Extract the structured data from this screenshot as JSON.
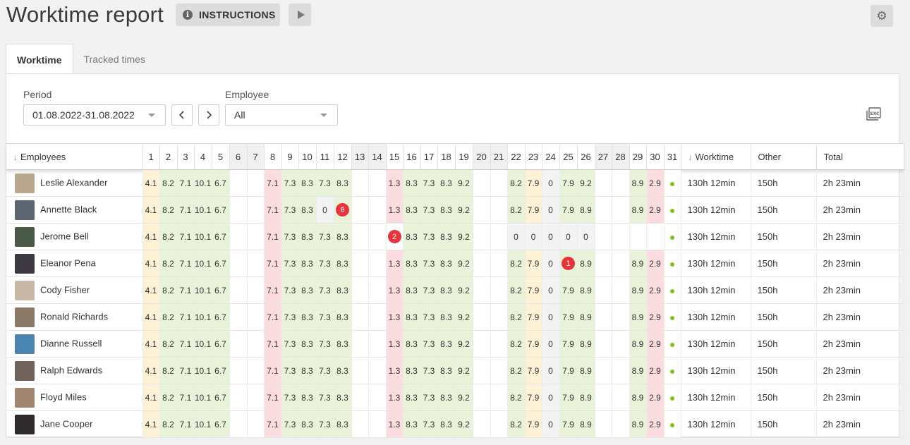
{
  "header": {
    "title": "Worktime report",
    "instructions_label": "INSTRUCTIONS",
    "info_icon": "info-icon",
    "play_icon": "play-icon",
    "settings_icon": "gear-icon"
  },
  "tabs": [
    {
      "label": "Worktime",
      "active": true
    },
    {
      "label": "Tracked times",
      "active": false
    }
  ],
  "filters": {
    "period_label": "Period",
    "period_value": "01.08.2022-31.08.2022",
    "employee_label": "Employee",
    "employee_value": "All",
    "export_icon": "excel-export-icon"
  },
  "colors": {
    "yellow_cell": "#fdf1d6",
    "green_cell": "#e8f3d9",
    "red_cell": "#fbdde0",
    "gray_cell": "#f3f3f3",
    "badge": "#e8323c",
    "status_dot": "#7dc31f"
  },
  "table": {
    "employees_header": "Employees",
    "worktime_header": "Worktime",
    "other_header": "Other",
    "total_header": "Total",
    "days": [
      "1",
      "2",
      "3",
      "4",
      "5",
      "6",
      "7",
      "8",
      "9",
      "10",
      "11",
      "12",
      "13",
      "14",
      "15",
      "16",
      "17",
      "18",
      "19",
      "20",
      "21",
      "22",
      "23",
      "24",
      "25",
      "26",
      "27",
      "28",
      "29",
      "30",
      "31"
    ],
    "weekend_days": [
      6,
      7,
      13,
      14,
      20,
      21,
      27,
      28
    ],
    "rows": [
      {
        "name": "Leslie Alexander",
        "avatar_color": "#b9a78f",
        "cells": [
          "4.1",
          "8.2",
          "7.1",
          "10.1",
          "6.7",
          "",
          "",
          "7.1",
          "7.3",
          "8.3",
          "7.3",
          "8.3",
          "",
          "",
          "1.3",
          "8.3",
          "7.3",
          "8.3",
          "9.2",
          "",
          "",
          "8.2",
          "7.9",
          "0",
          "7.9",
          "9.2",
          "",
          "",
          "8.9",
          "2.9",
          "•"
        ],
        "worktime": "130h 12min",
        "other": "150h",
        "total": "2h 23min"
      },
      {
        "name": "Annette Black",
        "avatar_color": "#5d6670",
        "cells": [
          "4.1",
          "8.2",
          "7.1",
          "10.1",
          "6.7",
          "",
          "",
          "7.1",
          "7.3",
          "8.3",
          "0",
          "!8",
          "",
          "",
          "1.3",
          "8.3",
          "7.3",
          "8.3",
          "9.2",
          "",
          "",
          "8.2",
          "7.9",
          "0",
          "7.9",
          "8.9",
          "",
          "",
          "8.9",
          "2.9",
          "•"
        ],
        "worktime": "130h 12min",
        "other": "150h",
        "total": "2h 23min"
      },
      {
        "name": "Jerome Bell",
        "avatar_color": "#4a5a48",
        "cells": [
          "4.1",
          "8.2",
          "7.1",
          "10.1",
          "6.7",
          "",
          "",
          "7.1",
          "7.3",
          "8.3",
          "7.3",
          "8.3",
          "",
          "",
          "!2",
          "8.3",
          "7.3",
          "8.3",
          "9.2",
          "",
          "",
          "0",
          "0",
          "0",
          "0",
          "0",
          "",
          "",
          "",
          "",
          "•"
        ],
        "worktime": "130h 12min",
        "other": "150h",
        "total": "2h 23min"
      },
      {
        "name": "Eleanor Pena",
        "avatar_color": "#3c3a40",
        "cells": [
          "4.1",
          "8.2",
          "7.1",
          "10.1",
          "6.7",
          "",
          "",
          "7.1",
          "7.3",
          "8.3",
          "7.3",
          "8.3",
          "",
          "",
          "1.3",
          "8.3",
          "7.3",
          "8.3",
          "9.2",
          "",
          "",
          "8.2",
          "7.9",
          "0",
          "!1",
          "8.9",
          "",
          "",
          "8.9",
          "2.9",
          "•"
        ],
        "worktime": "130h 12min",
        "other": "150h",
        "total": "2h 23min"
      },
      {
        "name": "Cody Fisher",
        "avatar_color": "#c9b8a6",
        "cells": [
          "4.1",
          "8.2",
          "7.1",
          "10.1",
          "6.7",
          "",
          "",
          "7.1",
          "7.3",
          "8.3",
          "7.3",
          "8.3",
          "",
          "",
          "1.3",
          "8.3",
          "7.3",
          "8.3",
          "9.2",
          "",
          "",
          "8.2",
          "7.9",
          "0",
          "7.9",
          "8.9",
          "",
          "",
          "8.9",
          "2.9",
          "•"
        ],
        "worktime": "130h 12min",
        "other": "150h",
        "total": "2h 23min"
      },
      {
        "name": "Ronald Richards",
        "avatar_color": "#8c7a68",
        "cells": [
          "4.1",
          "8.2",
          "7.1",
          "10.1",
          "6.7",
          "",
          "",
          "7.1",
          "7.3",
          "8.3",
          "7.3",
          "8.3",
          "",
          "",
          "1.3",
          "8.3",
          "7.3",
          "8.3",
          "9.2",
          "",
          "",
          "8.2",
          "7.9",
          "0",
          "7.9",
          "8.9",
          "",
          "",
          "8.9",
          "2.9",
          "•"
        ],
        "worktime": "130h 12min",
        "other": "150h",
        "total": "2h 23min"
      },
      {
        "name": "Dianne Russell",
        "avatar_color": "#4a86b0",
        "cells": [
          "4.1",
          "8.2",
          "7.1",
          "10.1",
          "6.7",
          "",
          "",
          "7.1",
          "7.3",
          "8.3",
          "7.3",
          "8.3",
          "",
          "",
          "1.3",
          "8.3",
          "7.3",
          "8.3",
          "9.2",
          "",
          "",
          "8.2",
          "7.9",
          "0",
          "7.9",
          "8.9",
          "",
          "",
          "8.9",
          "2.9",
          "•"
        ],
        "worktime": "130h 12min",
        "other": "150h",
        "total": "2h 23min"
      },
      {
        "name": "Ralph Edwards",
        "avatar_color": "#6e625a",
        "cells": [
          "4.1",
          "8.2",
          "7.1",
          "10.1",
          "6.7",
          "",
          "",
          "7.1",
          "7.3",
          "8.3",
          "7.3",
          "8.3",
          "",
          "",
          "1.3",
          "8.3",
          "7.3",
          "8.3",
          "9.2",
          "",
          "",
          "8.2",
          "7.9",
          "0",
          "7.9",
          "8.9",
          "",
          "",
          "8.9",
          "2.9",
          "•"
        ],
        "worktime": "130h 12min",
        "other": "150h",
        "total": "2h 23min"
      },
      {
        "name": "Floyd Miles",
        "avatar_color": "#a08670",
        "cells": [
          "4.1",
          "8.2",
          "7.1",
          "10.1",
          "6.7",
          "",
          "",
          "7.1",
          "7.3",
          "8.3",
          "7.3",
          "8.3",
          "",
          "",
          "1.3",
          "8.3",
          "7.3",
          "8.3",
          "9.2",
          "",
          "",
          "8.2",
          "7.9",
          "0",
          "7.9",
          "8.9",
          "",
          "",
          "8.9",
          "2.9",
          "•"
        ],
        "worktime": "130h 12min",
        "other": "150h",
        "total": "2h 23min"
      },
      {
        "name": "Jane Cooper",
        "avatar_color": "#2e2a2c",
        "cells": [
          "4.1",
          "8.2",
          "7.1",
          "10.1",
          "6.7",
          "",
          "",
          "7.1",
          "7.3",
          "8.3",
          "7.3",
          "8.3",
          "",
          "",
          "1.3",
          "8.3",
          "7.3",
          "8.3",
          "9.2",
          "",
          "",
          "8.2",
          "7.9",
          "0",
          "7.9",
          "8.9",
          "",
          "",
          "8.9",
          "2.9",
          "•"
        ],
        "worktime": "130h 12min",
        "other": "150h",
        "total": "2h 23min"
      }
    ]
  }
}
